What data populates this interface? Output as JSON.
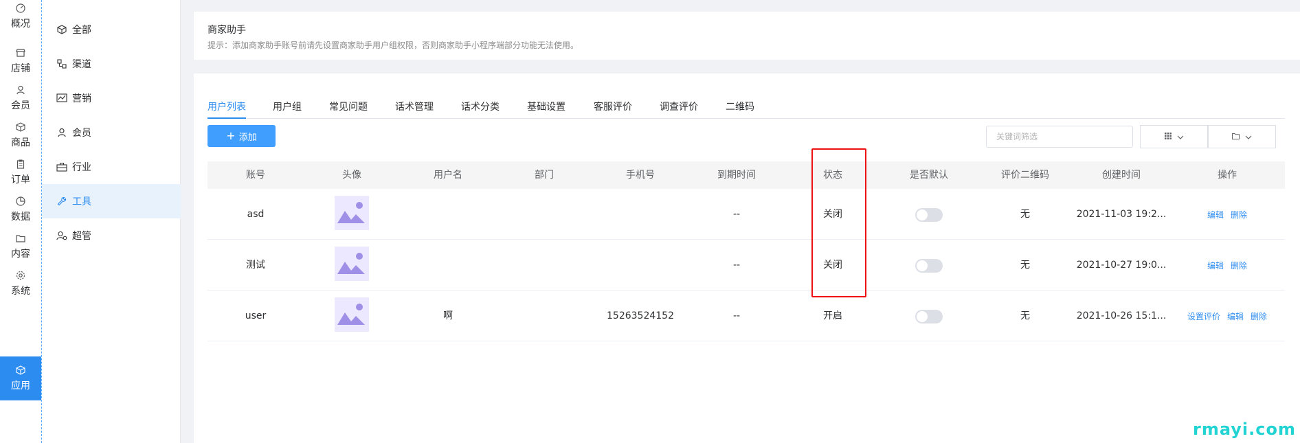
{
  "rail": {
    "items": [
      {
        "label": "概况",
        "icon": "dashboard-icon"
      },
      {
        "label": "店铺",
        "icon": "store-icon"
      },
      {
        "label": "会员",
        "icon": "user-icon"
      },
      {
        "label": "商品",
        "icon": "cube-icon"
      },
      {
        "label": "订单",
        "icon": "clipboard-icon"
      },
      {
        "label": "数据",
        "icon": "pie-icon"
      },
      {
        "label": "内容",
        "icon": "folder-icon"
      },
      {
        "label": "系统",
        "icon": "gear-icon"
      },
      {
        "label": "应用",
        "icon": "cube-icon"
      }
    ],
    "active": "应用"
  },
  "submenu": {
    "items": [
      {
        "label": "全部",
        "icon": "cube-icon"
      },
      {
        "label": "渠道",
        "icon": "channel-icon"
      },
      {
        "label": "营销",
        "icon": "chart-icon"
      },
      {
        "label": "会员",
        "icon": "user-icon"
      },
      {
        "label": "行业",
        "icon": "briefcase-icon"
      },
      {
        "label": "工具",
        "icon": "wrench-icon"
      },
      {
        "label": "超管",
        "icon": "admin-icon"
      }
    ],
    "active": "工具"
  },
  "info": {
    "title": "商家助手",
    "hint": "提示：添加商家助手账号前请先设置商家助手用户组权限，否则商家助手小程序端部分功能无法使用。"
  },
  "tabs": [
    "用户列表",
    "用户组",
    "常见问题",
    "话术管理",
    "话术分类",
    "基础设置",
    "客服评价",
    "调查评价",
    "二维码"
  ],
  "toolbar": {
    "add_label": "添加",
    "search_placeholder": "关键词筛选"
  },
  "table": {
    "headers": [
      "账号",
      "头像",
      "用户名",
      "部门",
      "手机号",
      "到期时间",
      "状态",
      "是否默认",
      "评价二维码",
      "创建时间",
      "操作"
    ],
    "rows": [
      {
        "account": "asd",
        "username": "",
        "dept": "",
        "phone": "",
        "expire": "--",
        "status": "关闭",
        "qrcode": "无",
        "created": "2021-11-03 19:2...",
        "ops": [
          "编辑",
          "删除"
        ]
      },
      {
        "account": "测试",
        "username": "",
        "dept": "",
        "phone": "",
        "expire": "--",
        "status": "关闭",
        "qrcode": "无",
        "created": "2021-10-27 19:0...",
        "ops": [
          "编辑",
          "删除"
        ]
      },
      {
        "account": "user",
        "username": "啊",
        "dept": "",
        "phone": "15263524152",
        "expire": "--",
        "status": "开启",
        "qrcode": "无",
        "created": "2021-10-26 15:1...",
        "ops": [
          "设置评价",
          "编辑",
          "删除"
        ]
      }
    ]
  },
  "watermark": "rmayi.com",
  "colors": {
    "primary": "#2d8cf0",
    "highlight": "#e11111",
    "watermark": "#22d3d3"
  }
}
